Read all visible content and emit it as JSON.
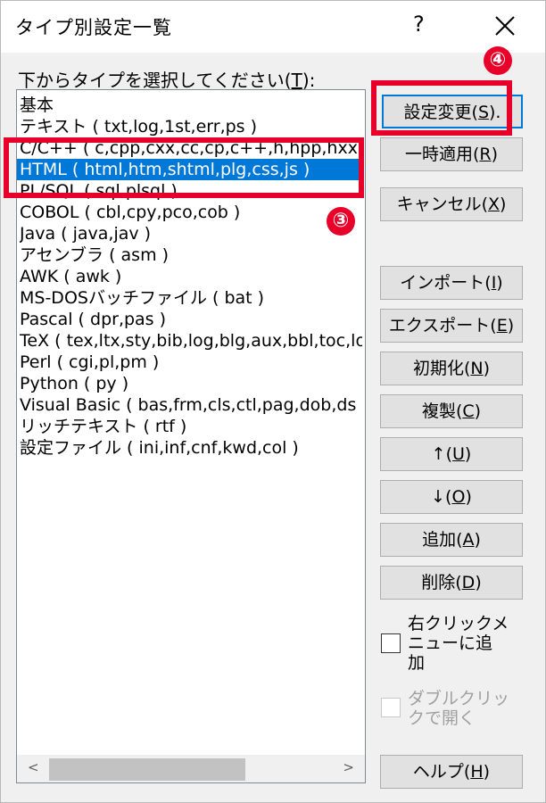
{
  "window": {
    "title": "タイプ別設定一覧",
    "help_glyph": "?"
  },
  "list": {
    "prompt_text": "下からタイプを選択してください(",
    "prompt_key": "T",
    "prompt_tail": "):",
    "items": [
      "基本",
      "テキスト ( txt,log,1st,err,ps )",
      "C/C++ ( c,cpp,cxx,cc,cp,c++,h,hpp,hxx",
      "HTML ( html,htm,shtml,plg,css,js )",
      "PL/SQL ( sql,plsql )",
      "COBOL ( cbl,cpy,pco,cob )",
      "Java ( java,jav )",
      "アセンブラ ( asm )",
      "AWK ( awk )",
      "MS-DOSバッチファイル ( bat )",
      "Pascal ( dpr,pas )",
      "TeX ( tex,ltx,sty,bib,log,blg,aux,bbl,toc,lo",
      "Perl ( cgi,pl,pm )",
      "Python ( py )",
      "Visual Basic ( bas,frm,cls,ctl,pag,dob,ds",
      "リッチテキスト ( rtf )",
      "設定ファイル ( ini,inf,cnf,kwd,col )"
    ],
    "selected_index": 3,
    "scroll_left": "<",
    "scroll_right": ">"
  },
  "buttons": {
    "change": {
      "text": "設定変更(",
      "key": "S",
      "tail": ")."
    },
    "apply": {
      "text": "一時適用(",
      "key": "R",
      "tail": ")"
    },
    "cancel": {
      "text": "キャンセル(",
      "key": "X",
      "tail": ")"
    },
    "import": {
      "text": "インポート(",
      "key": "I",
      "tail": ")"
    },
    "export": {
      "text": "エクスポート(",
      "key": "E",
      "tail": ")"
    },
    "reset": {
      "text": "初期化(",
      "key": "N",
      "tail": ")"
    },
    "duplicate": {
      "text": "複製(",
      "key": "C",
      "tail": ")"
    },
    "up": {
      "text": "↑(",
      "key": "U",
      "tail": ")"
    },
    "down": {
      "text": "↓(",
      "key": "O",
      "tail": ")"
    },
    "add": {
      "text": "追加(",
      "key": "A",
      "tail": ")"
    },
    "delete": {
      "text": "削除(",
      "key": "D",
      "tail": ")"
    },
    "help": {
      "text": "ヘルプ(",
      "key": "H",
      "tail": ")"
    }
  },
  "checkboxes": {
    "context_menu": {
      "label": "右クリックメ\nニューに追\n加",
      "checked": false,
      "enabled": true
    },
    "double_click": {
      "label": "ダブルクリッ\nクで開く",
      "checked": false,
      "enabled": false
    }
  },
  "annotations": {
    "callout_3": "③",
    "callout_4": "④",
    "color": "#e8002a"
  },
  "colors": {
    "selection": "#0078d7",
    "dialog_bg": "#f0f0f0"
  }
}
